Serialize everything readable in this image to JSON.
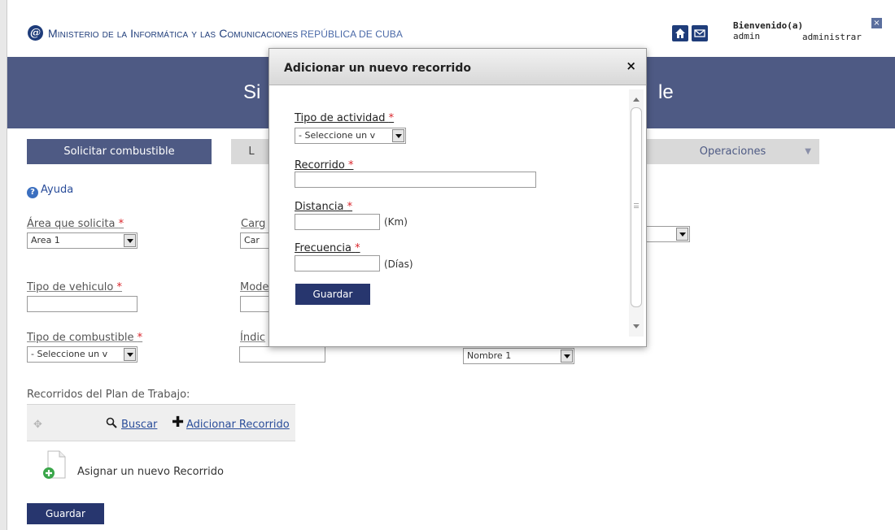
{
  "header": {
    "ministry_prefix": "Ministerio de la Informática y las Comunicaciones",
    "ministry_suffix": "REPÚBLICA DE CUBA",
    "welcome": "Bienvenido(a)",
    "user": "admin",
    "role": "administrar"
  },
  "banner": {
    "title_left": "Si",
    "title_right": "le"
  },
  "tabs": {
    "solicitar": "Solicitar combustible",
    "second": "L",
    "operaciones": "Operaciones"
  },
  "help": "Ayuda",
  "form": {
    "area_label": "Área que solicita",
    "area_value": "Area 1",
    "cargo_label": "Carg",
    "cargo_value": "Car",
    "tipo_vehiculo_label": "Tipo de vehiculo",
    "modelo_label": "Mode",
    "tipo_combustible_label": "Tipo de combustible",
    "tipo_combustible_value": "- Seleccione un v",
    "indice_label": "Índic",
    "nombre_value": "Nombre 1",
    "required_mark": "*"
  },
  "routes": {
    "label": "Recorridos del Plan de Trabajo:",
    "search": "Buscar",
    "add": "Adicionar Recorrido",
    "assign": "Asignar un nuevo Recorrido",
    "save": "Guardar"
  },
  "modal": {
    "title": "Adicionar un nuevo recorrido",
    "close": "×",
    "tipo_actividad_label": "Tipo de actividad",
    "tipo_actividad_value": "- Seleccione un v",
    "recorrido_label": "Recorrido",
    "distancia_label": "Distancia",
    "distancia_unit": "(Km)",
    "frecuencia_label": "Frecuencia",
    "frecuencia_unit": "(Días)",
    "save": "Guardar"
  },
  "colors": {
    "brand": "#4e5a84",
    "button": "#27366e",
    "required": "#d9242a",
    "link": "#2a4d9a"
  }
}
